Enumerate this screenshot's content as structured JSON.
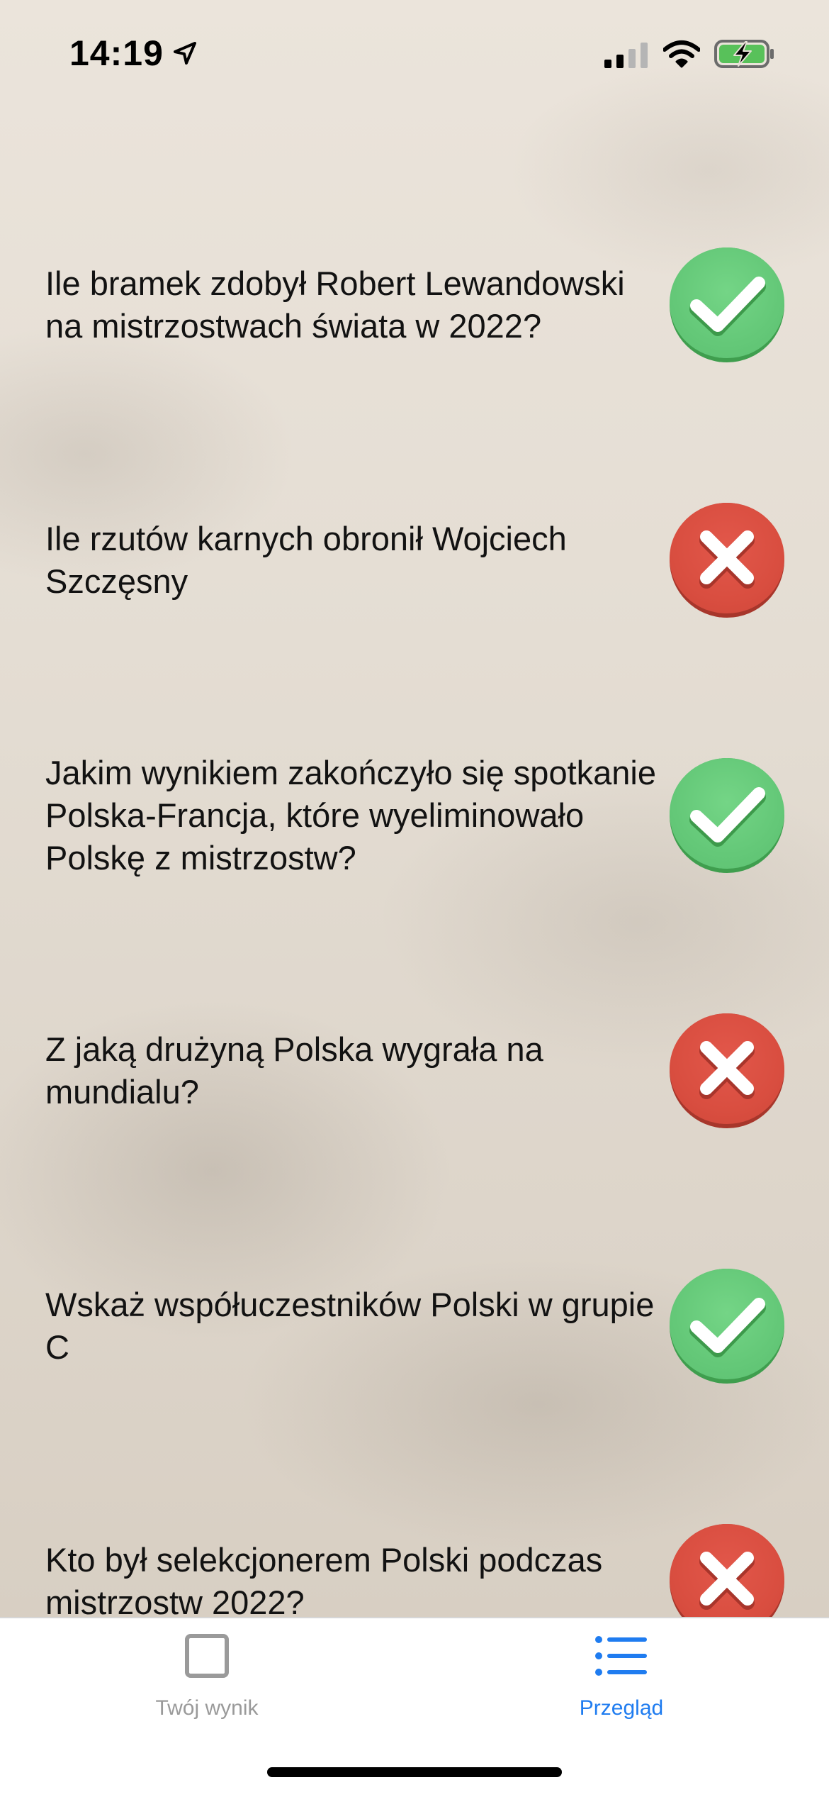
{
  "status_bar": {
    "time": "14:19",
    "location_icon": "location-arrow-icon",
    "signal_icon": "cellular-signal-icon",
    "wifi_icon": "wifi-icon",
    "battery_icon": "battery-charging-icon"
  },
  "questions": [
    {
      "text": "Ile bramek zdobył Robert Lewandowski na mistrzostwach świata w 2022?",
      "result": "correct",
      "icon": "checkmark-icon"
    },
    {
      "text": "Ile rzutów karnych obronił Wojciech Szczęsny",
      "result": "wrong",
      "icon": "cross-icon"
    },
    {
      "text": "Jakim wynikiem zakończyło się spotkanie Polska-Francja, które wyeliminowało Polskę z mistrzostw?",
      "result": "correct",
      "icon": "checkmark-icon"
    },
    {
      "text": "Z jaką drużyną Polska wygrała na mundialu?",
      "result": "wrong",
      "icon": "cross-icon"
    },
    {
      "text": "Wskaż współuczestników Polski w grupie C",
      "result": "correct",
      "icon": "checkmark-icon"
    },
    {
      "text": "Kto był selekcjonerem Polski podczas mistrzostw 2022?",
      "result": "wrong",
      "icon": "cross-icon"
    }
  ],
  "tab_bar": {
    "tabs": [
      {
        "label": "Twój wynik",
        "icon": "square-icon",
        "active": false
      },
      {
        "label": "Przegląd",
        "icon": "list-icon",
        "active": true
      }
    ]
  },
  "colors": {
    "correct_green": "#64c878",
    "wrong_red": "#d94e40",
    "active_tab_blue": "#1f7cf0",
    "inactive_tab_gray": "#9a9a9a"
  }
}
